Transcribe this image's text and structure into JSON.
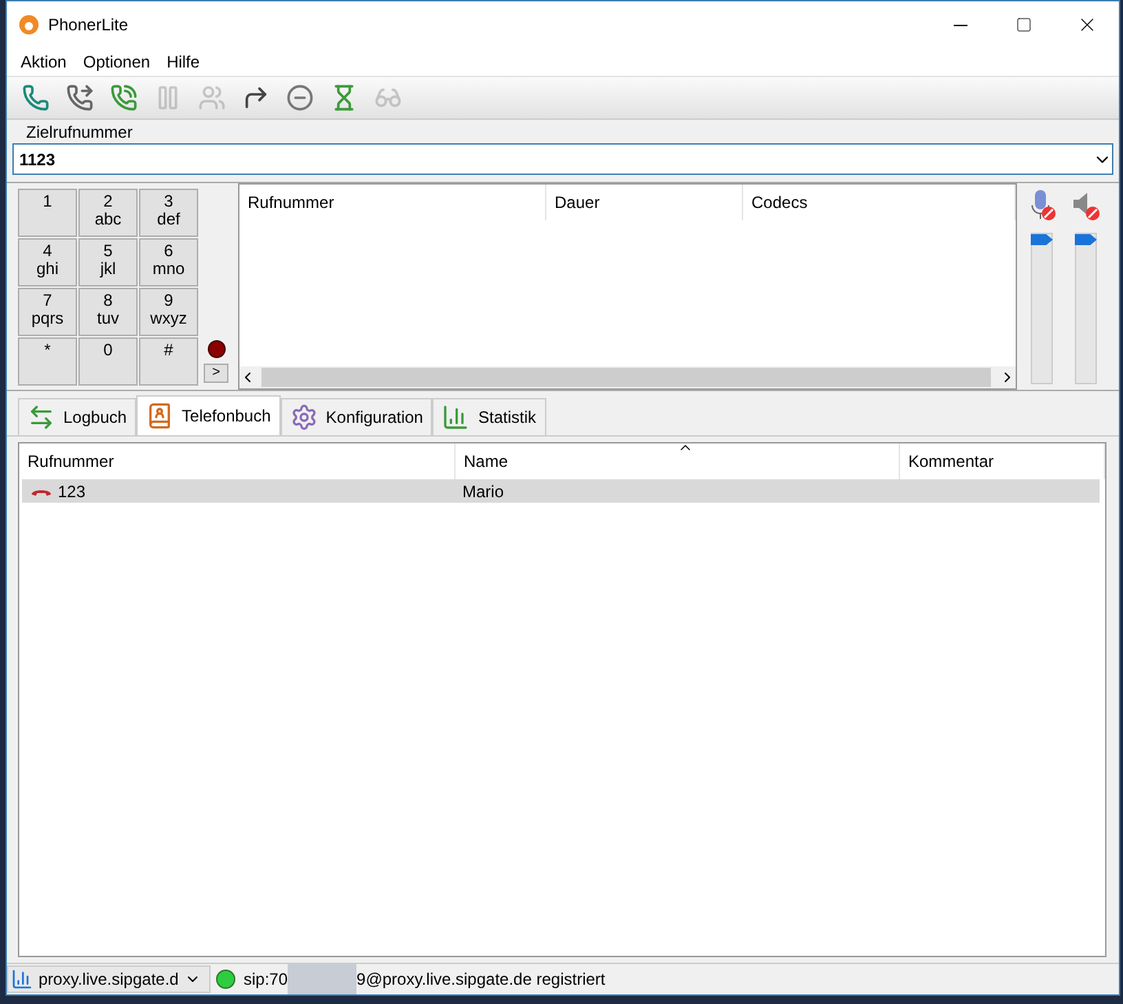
{
  "window": {
    "title": "PhonerLite"
  },
  "menu": [
    "Aktion",
    "Optionen",
    "Hilfe"
  ],
  "toolbar": [
    {
      "kind": "call",
      "disabled": false
    },
    {
      "kind": "hangup",
      "disabled": false
    },
    {
      "kind": "callback",
      "disabled": false
    },
    {
      "kind": "hold",
      "disabled": true
    },
    {
      "kind": "conference",
      "disabled": true
    },
    {
      "kind": "forward",
      "disabled": false
    },
    {
      "kind": "reject",
      "disabled": false
    },
    {
      "kind": "wait",
      "disabled": false
    },
    {
      "kind": "anonymous",
      "disabled": true
    }
  ],
  "target": {
    "label": "Zielrufnummer",
    "value": "1123"
  },
  "keypad": [
    {
      "digit": "1"
    },
    {
      "digit": "2",
      "letters": "abc"
    },
    {
      "digit": "3",
      "letters": "def"
    },
    {
      "digit": "4",
      "letters": "ghi"
    },
    {
      "digit": "5",
      "letters": "jkl"
    },
    {
      "digit": "6",
      "letters": "mno"
    },
    {
      "digit": "7",
      "letters": "pqrs"
    },
    {
      "digit": "8",
      "letters": "tuv"
    },
    {
      "digit": "9",
      "letters": "wxyz"
    },
    {
      "digit": "*"
    },
    {
      "digit": "0"
    },
    {
      "digit": "#"
    }
  ],
  "expand_button": ">",
  "calls": {
    "columns": [
      "Rufnummer",
      "Dauer",
      "Codecs"
    ]
  },
  "audio": {
    "mic": {
      "level": 1.0
    },
    "speaker": {
      "level": 1.0
    }
  },
  "tabs": [
    {
      "label": "Logbuch",
      "kind": "log",
      "selected": false
    },
    {
      "label": "Telefonbuch",
      "kind": "book",
      "selected": true
    },
    {
      "label": "Konfiguration",
      "kind": "config",
      "selected": false
    },
    {
      "label": "Statistik",
      "kind": "stats",
      "selected": false
    }
  ],
  "phonebook": {
    "columns": [
      {
        "label": "Rufnummer",
        "sorted": false
      },
      {
        "label": "Name",
        "sorted": true
      },
      {
        "label": "Kommentar",
        "sorted": false
      }
    ],
    "rows": [
      {
        "number": "123",
        "name": "Mario",
        "selected": true
      }
    ]
  },
  "status_bar": {
    "proxy": "proxy.live.sipgate.d",
    "registered": true,
    "text_start": "sip:70",
    "text_end": "9@proxy.live.sipgate.de registriert"
  }
}
